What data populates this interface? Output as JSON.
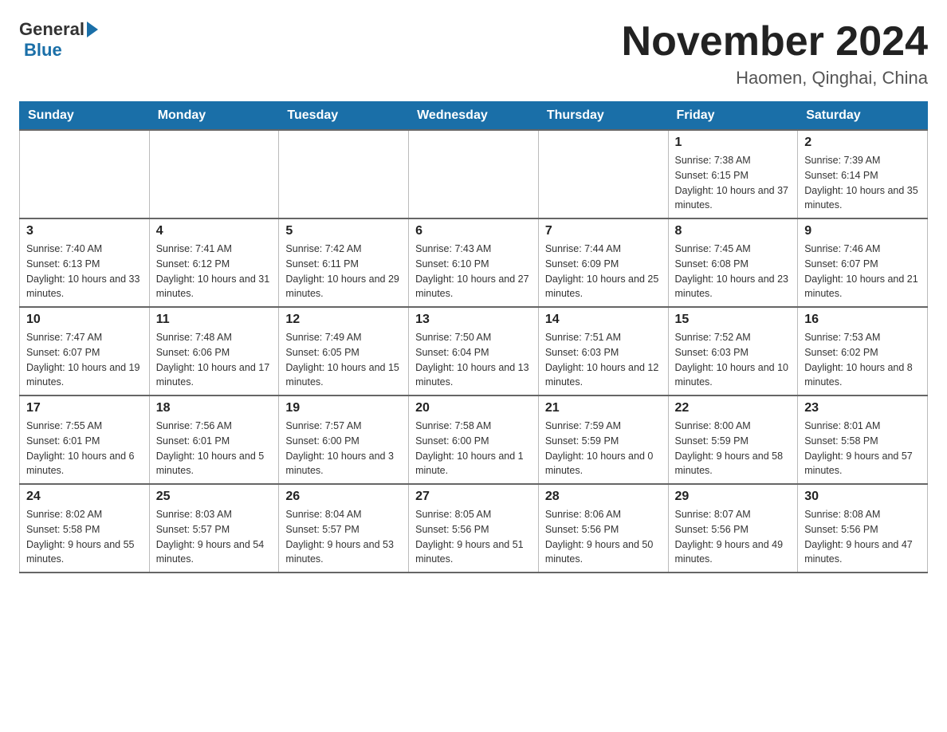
{
  "header": {
    "logo": {
      "general": "General",
      "blue": "Blue"
    },
    "title": "November 2024",
    "location": "Haomen, Qinghai, China"
  },
  "days_of_week": [
    "Sunday",
    "Monday",
    "Tuesday",
    "Wednesday",
    "Thursday",
    "Friday",
    "Saturday"
  ],
  "weeks": [
    [
      {
        "day": "",
        "info": ""
      },
      {
        "day": "",
        "info": ""
      },
      {
        "day": "",
        "info": ""
      },
      {
        "day": "",
        "info": ""
      },
      {
        "day": "",
        "info": ""
      },
      {
        "day": "1",
        "info": "Sunrise: 7:38 AM\nSunset: 6:15 PM\nDaylight: 10 hours and 37 minutes."
      },
      {
        "day": "2",
        "info": "Sunrise: 7:39 AM\nSunset: 6:14 PM\nDaylight: 10 hours and 35 minutes."
      }
    ],
    [
      {
        "day": "3",
        "info": "Sunrise: 7:40 AM\nSunset: 6:13 PM\nDaylight: 10 hours and 33 minutes."
      },
      {
        "day": "4",
        "info": "Sunrise: 7:41 AM\nSunset: 6:12 PM\nDaylight: 10 hours and 31 minutes."
      },
      {
        "day": "5",
        "info": "Sunrise: 7:42 AM\nSunset: 6:11 PM\nDaylight: 10 hours and 29 minutes."
      },
      {
        "day": "6",
        "info": "Sunrise: 7:43 AM\nSunset: 6:10 PM\nDaylight: 10 hours and 27 minutes."
      },
      {
        "day": "7",
        "info": "Sunrise: 7:44 AM\nSunset: 6:09 PM\nDaylight: 10 hours and 25 minutes."
      },
      {
        "day": "8",
        "info": "Sunrise: 7:45 AM\nSunset: 6:08 PM\nDaylight: 10 hours and 23 minutes."
      },
      {
        "day": "9",
        "info": "Sunrise: 7:46 AM\nSunset: 6:07 PM\nDaylight: 10 hours and 21 minutes."
      }
    ],
    [
      {
        "day": "10",
        "info": "Sunrise: 7:47 AM\nSunset: 6:07 PM\nDaylight: 10 hours and 19 minutes."
      },
      {
        "day": "11",
        "info": "Sunrise: 7:48 AM\nSunset: 6:06 PM\nDaylight: 10 hours and 17 minutes."
      },
      {
        "day": "12",
        "info": "Sunrise: 7:49 AM\nSunset: 6:05 PM\nDaylight: 10 hours and 15 minutes."
      },
      {
        "day": "13",
        "info": "Sunrise: 7:50 AM\nSunset: 6:04 PM\nDaylight: 10 hours and 13 minutes."
      },
      {
        "day": "14",
        "info": "Sunrise: 7:51 AM\nSunset: 6:03 PM\nDaylight: 10 hours and 12 minutes."
      },
      {
        "day": "15",
        "info": "Sunrise: 7:52 AM\nSunset: 6:03 PM\nDaylight: 10 hours and 10 minutes."
      },
      {
        "day": "16",
        "info": "Sunrise: 7:53 AM\nSunset: 6:02 PM\nDaylight: 10 hours and 8 minutes."
      }
    ],
    [
      {
        "day": "17",
        "info": "Sunrise: 7:55 AM\nSunset: 6:01 PM\nDaylight: 10 hours and 6 minutes."
      },
      {
        "day": "18",
        "info": "Sunrise: 7:56 AM\nSunset: 6:01 PM\nDaylight: 10 hours and 5 minutes."
      },
      {
        "day": "19",
        "info": "Sunrise: 7:57 AM\nSunset: 6:00 PM\nDaylight: 10 hours and 3 minutes."
      },
      {
        "day": "20",
        "info": "Sunrise: 7:58 AM\nSunset: 6:00 PM\nDaylight: 10 hours and 1 minute."
      },
      {
        "day": "21",
        "info": "Sunrise: 7:59 AM\nSunset: 5:59 PM\nDaylight: 10 hours and 0 minutes."
      },
      {
        "day": "22",
        "info": "Sunrise: 8:00 AM\nSunset: 5:59 PM\nDaylight: 9 hours and 58 minutes."
      },
      {
        "day": "23",
        "info": "Sunrise: 8:01 AM\nSunset: 5:58 PM\nDaylight: 9 hours and 57 minutes."
      }
    ],
    [
      {
        "day": "24",
        "info": "Sunrise: 8:02 AM\nSunset: 5:58 PM\nDaylight: 9 hours and 55 minutes."
      },
      {
        "day": "25",
        "info": "Sunrise: 8:03 AM\nSunset: 5:57 PM\nDaylight: 9 hours and 54 minutes."
      },
      {
        "day": "26",
        "info": "Sunrise: 8:04 AM\nSunset: 5:57 PM\nDaylight: 9 hours and 53 minutes."
      },
      {
        "day": "27",
        "info": "Sunrise: 8:05 AM\nSunset: 5:56 PM\nDaylight: 9 hours and 51 minutes."
      },
      {
        "day": "28",
        "info": "Sunrise: 8:06 AM\nSunset: 5:56 PM\nDaylight: 9 hours and 50 minutes."
      },
      {
        "day": "29",
        "info": "Sunrise: 8:07 AM\nSunset: 5:56 PM\nDaylight: 9 hours and 49 minutes."
      },
      {
        "day": "30",
        "info": "Sunrise: 8:08 AM\nSunset: 5:56 PM\nDaylight: 9 hours and 47 minutes."
      }
    ]
  ]
}
